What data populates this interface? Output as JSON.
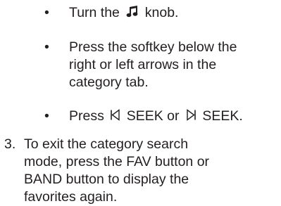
{
  "bullets": [
    {
      "mark": "•",
      "text_before": "Turn the",
      "icon": "music-note-icon",
      "text_after": "knob."
    },
    {
      "mark": "•",
      "lines": [
        "Press the softkey below the",
        "right or left arrows in the",
        "category tab."
      ]
    },
    {
      "mark": "•",
      "text_before": "Press",
      "icon_left": "seek-back-icon",
      "mid": "SEEK or",
      "icon_right": "seek-forward-icon",
      "text_after": "SEEK."
    }
  ],
  "steps": [
    {
      "number": "3.",
      "lines": [
        "To exit the category search",
        "mode, press the FAV button or",
        "BAND button to display the",
        "favorites again."
      ]
    }
  ]
}
